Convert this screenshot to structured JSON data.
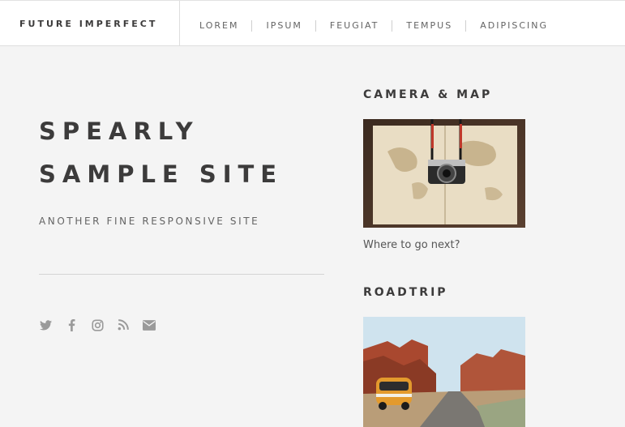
{
  "header": {
    "brand": "FUTURE IMPERFECT",
    "nav": [
      "LOREM",
      "IPSUM",
      "FEUGIAT",
      "TEMPUS",
      "ADIPISCING"
    ]
  },
  "intro": {
    "title_line1": "SPEARLY",
    "title_line2": "SAMPLE SITE",
    "subtitle": "ANOTHER FINE RESPONSIVE SITE"
  },
  "social_icons": [
    "twitter-icon",
    "facebook-icon",
    "instagram-icon",
    "rss-icon",
    "envelope-icon"
  ],
  "posts": [
    {
      "title": "CAMERA & MAP",
      "caption": "Where to go next?"
    },
    {
      "title": "ROADTRIP"
    }
  ],
  "colors": {
    "background": "#f4f4f4",
    "header_bg": "#ffffff",
    "text_dark": "#3c3b3b",
    "text_muted": "#646464",
    "icon_gray": "#9a9a9a"
  }
}
